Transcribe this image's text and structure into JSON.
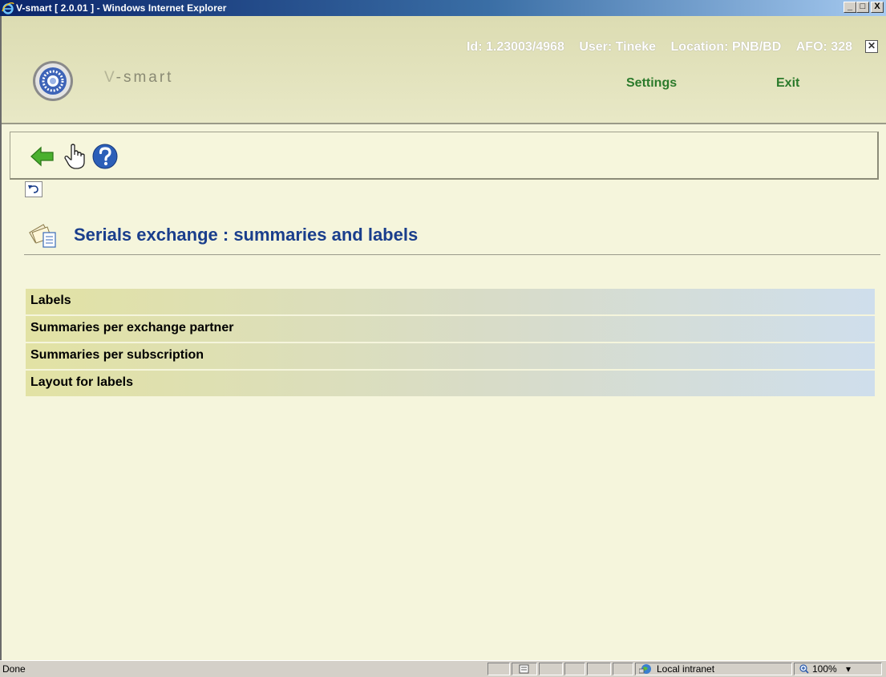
{
  "window": {
    "title": "V-smart [ 2.0.01 ] - Windows Internet Explorer",
    "minimize": "_",
    "maximize": "□",
    "close": "X"
  },
  "header": {
    "id_text": "Id: 1.23003/4968",
    "user_text": "User: Tineke",
    "location_text": "Location: PNB/BD",
    "afo_text": "AFO: 328",
    "close_glyph": "✕",
    "brand_prefix": "V",
    "brand_rest": "-smart",
    "settings_label": "Settings",
    "exit_label": "Exit"
  },
  "toolbar": {
    "icons": [
      "back-arrow-icon",
      "hand-pointer-icon",
      "help-icon"
    ]
  },
  "page": {
    "title": "Serials exchange : summaries and labels",
    "menu_items": [
      "Labels",
      "Summaries per exchange partner",
      "Summaries per subscription",
      "Layout for labels"
    ]
  },
  "statusbar": {
    "status": "Done",
    "zone": "Local intranet",
    "zoom": "100%",
    "zoom_caret": "▾"
  },
  "colors": {
    "title_blue": "#1a3e8c",
    "nav_green": "#2b7a2b",
    "background": "#f5f5dc"
  }
}
